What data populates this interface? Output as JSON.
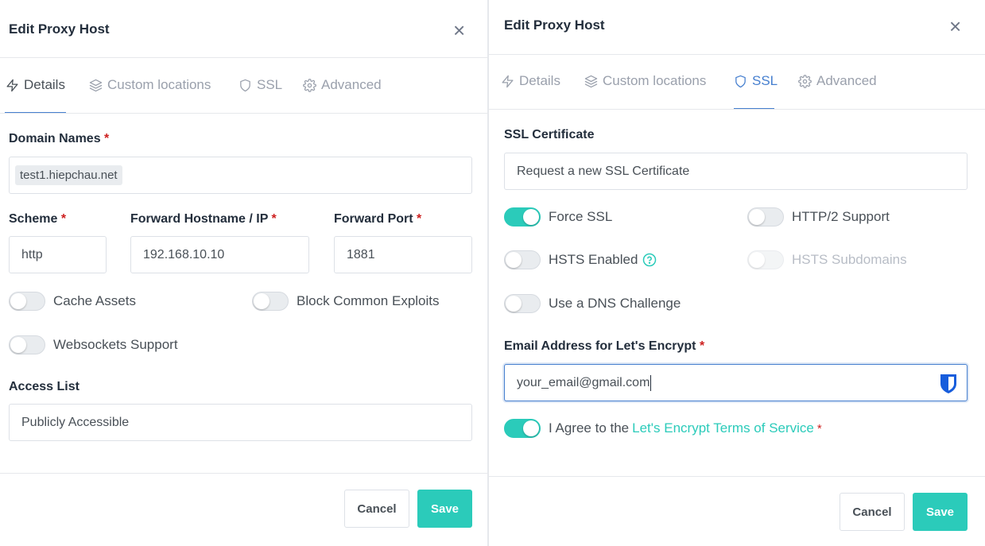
{
  "left": {
    "title": "Edit Proxy Host",
    "close": "×",
    "tabs": {
      "details": "Details",
      "custom": "Custom locations",
      "ssl": "SSL",
      "advanced": "Advanced"
    },
    "domain_label": "Domain Names",
    "domain_chip": "test1.hiepchau.net",
    "scheme_label": "Scheme",
    "scheme_value": "http",
    "host_label": "Forward Hostname / IP",
    "host_value": "192.168.10.10",
    "port_label": "Forward Port",
    "port_value": "1881",
    "cache_assets": "Cache Assets",
    "block_exploits": "Block Common Exploits",
    "websockets": "Websockets Support",
    "access_label": "Access List",
    "access_value": "Publicly Accessible",
    "cancel": "Cancel",
    "save": "Save"
  },
  "right": {
    "title": "Edit Proxy Host",
    "close": "×",
    "tabs": {
      "details": "Details",
      "custom": "Custom locations",
      "ssl": "SSL",
      "advanced": "Advanced"
    },
    "cert_label": "SSL Certificate",
    "cert_value": "Request a new SSL Certificate",
    "force_ssl": "Force SSL",
    "http2": "HTTP/2 Support",
    "hsts": "HSTS Enabled",
    "hsts_sub": "HSTS Subdomains",
    "dns": "Use a DNS Challenge",
    "email_label": "Email Address for Let's Encrypt",
    "email_value": "your_email@gmail.com",
    "agree_prefix": "I Agree to the",
    "agree_link": "Let's Encrypt Terms of Service",
    "cancel": "Cancel",
    "save": "Save"
  },
  "required_mark": "*",
  "colors": {
    "accent": "#2bcbba",
    "primary": "#467fcf",
    "required": "#cd201f"
  }
}
